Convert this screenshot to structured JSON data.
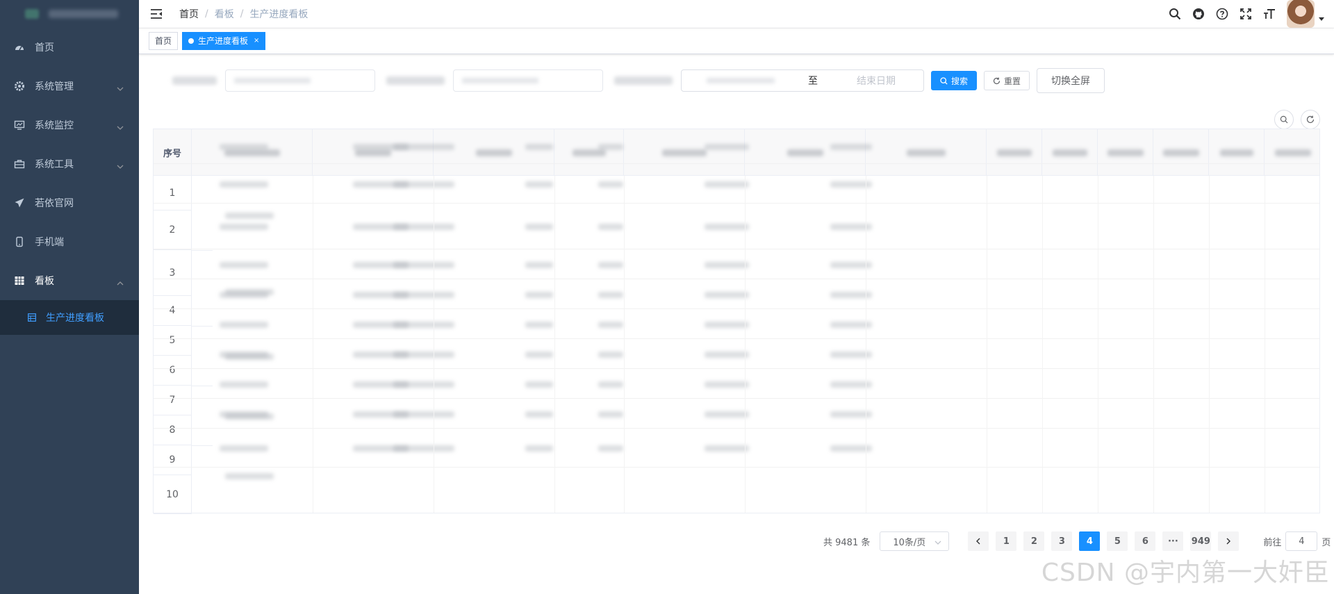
{
  "sidebar": {
    "items": [
      {
        "label": "首页",
        "icon": "dashboard-icon"
      },
      {
        "label": "系统管理",
        "icon": "system-icon"
      },
      {
        "label": "系统监控",
        "icon": "monitor-icon"
      },
      {
        "label": "系统工具",
        "icon": "tool-icon"
      },
      {
        "label": "若依官网",
        "icon": "guide-icon"
      },
      {
        "label": "手机端",
        "icon": "phone-icon"
      },
      {
        "label": "看板",
        "icon": "board-icon"
      }
    ],
    "sub_item": "生产进度看板"
  },
  "breadcrumb": {
    "first": "首页",
    "second": "看板",
    "third": "生产进度看板"
  },
  "tags": {
    "home": "首页",
    "active": "生产进度看板",
    "close": "×"
  },
  "search": {
    "date_to": "至",
    "date_end_placeholder": "结束日期",
    "search_label": "搜索",
    "reset_label": "重置",
    "fullscreen_label": "切换全屏"
  },
  "table": {
    "seq_header": "序号",
    "rows": [
      "1",
      "2",
      "3",
      "4",
      "5",
      "6",
      "7",
      "8",
      "9",
      "10"
    ]
  },
  "pagination": {
    "total": "共 9481 条",
    "page_size": "10条/页",
    "pages": [
      "1",
      "2",
      "3",
      "4",
      "5",
      "6"
    ],
    "ellipsis": "···",
    "last": "949",
    "current": "4",
    "goto_label": "前往",
    "goto_value": "4",
    "page_suffix": "页"
  },
  "watermark": "CSDN @宇内第一大奸臣",
  "colors": {
    "sidebar": "#304156",
    "accent": "#1890ff",
    "sub_active_bg": "#1f2d3d"
  }
}
